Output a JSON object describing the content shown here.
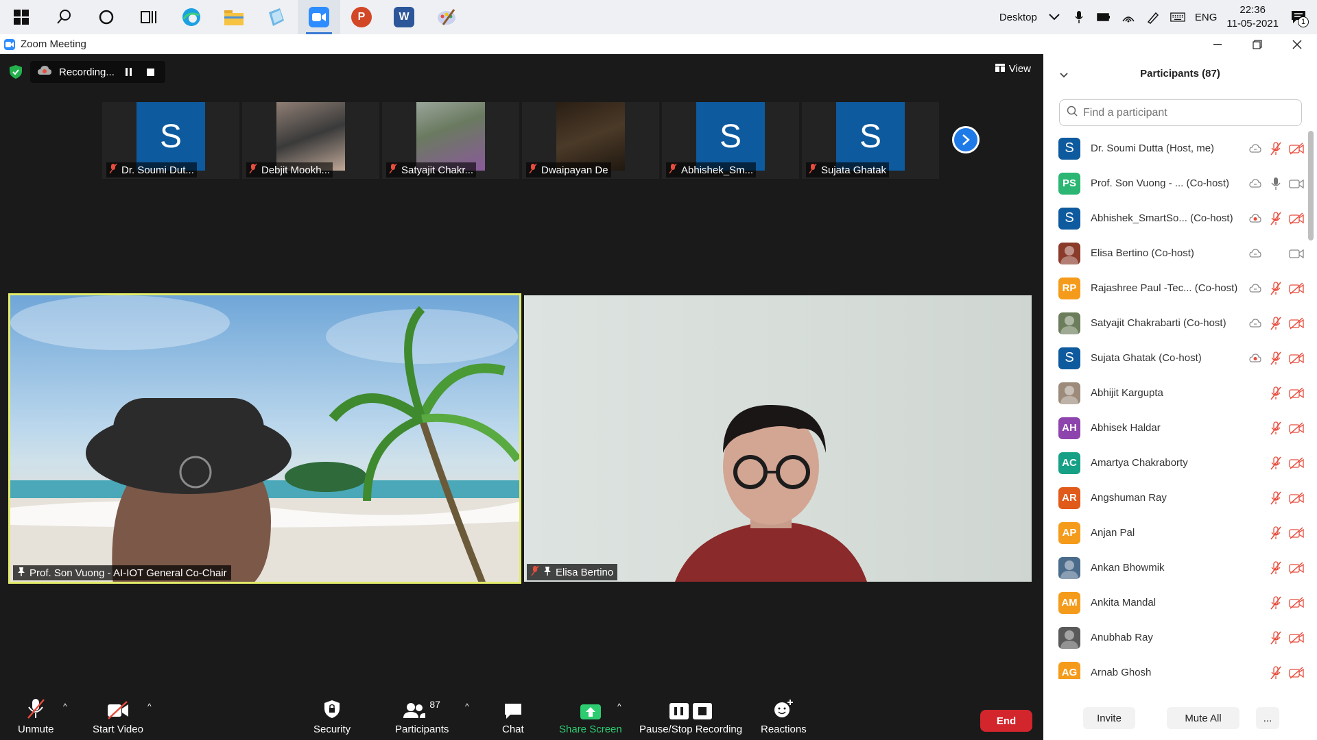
{
  "taskbar": {
    "apps": [
      {
        "name": "windows-start",
        "color": "#111111"
      },
      {
        "name": "search",
        "color": "#111111"
      },
      {
        "name": "cortana",
        "color": "#111111"
      },
      {
        "name": "task-view",
        "color": "#111111"
      },
      {
        "name": "edge",
        "color": "#1ba1e2"
      },
      {
        "name": "file-explorer",
        "color": "#f6c343"
      },
      {
        "name": "notes",
        "color": "#6fb7e6"
      },
      {
        "name": "zoom",
        "color": "#2d8cff"
      },
      {
        "name": "powerpoint",
        "color": "#d24726"
      },
      {
        "name": "word",
        "color": "#2b579a"
      },
      {
        "name": "paint",
        "color": "#9aa7d6"
      }
    ],
    "desktop_label": "Desktop",
    "lang": "ENG",
    "time": "22:36",
    "date": "11-05-2021",
    "notification_count": "1"
  },
  "window": {
    "title": "Zoom Meeting"
  },
  "meeting": {
    "recording_label": "Recording...",
    "view_label": "View",
    "thumbnails": [
      {
        "name": "Dr. Soumi Dut...",
        "initial": "S",
        "photo": ""
      },
      {
        "name": "Debjit Mookh...",
        "initial": "",
        "photo": "photo1"
      },
      {
        "name": "Satyajit Chakr...",
        "initial": "",
        "photo": "photo2"
      },
      {
        "name": "Dwaipayan De",
        "initial": "",
        "photo": "photo3"
      },
      {
        "name": "Abhishek_Sm...",
        "initial": "S",
        "photo": ""
      },
      {
        "name": "Sujata Ghatak",
        "initial": "S",
        "photo": ""
      }
    ],
    "main_videos": [
      {
        "name": "Prof. Son Vuong - AI-IOT General Co-Chair"
      },
      {
        "name": "Elisa Bertino"
      }
    ]
  },
  "toolbar": {
    "unmute": "Unmute",
    "start_video": "Start Video",
    "security": "Security",
    "participants": "Participants",
    "participants_count": "87",
    "chat": "Chat",
    "share_screen": "Share Screen",
    "pause_stop_recording": "Pause/Stop Recording",
    "reactions": "Reactions",
    "end": "End",
    "share_color": "#2ecc71",
    "end_color": "#d3252c"
  },
  "panel": {
    "title": "Participants (87)",
    "search_placeholder": "Find a participant",
    "participants": [
      {
        "name": "Dr. Soumi Dutta (Host, me)",
        "initials": "S",
        "color": "#0e5a9e",
        "big": true,
        "audio": "muted",
        "video": "off",
        "cloud": true,
        "cloud_red": false
      },
      {
        "name": "Prof. Son Vuong - ... (Co-host)",
        "initials": "PS",
        "color": "#2bb673",
        "big": false,
        "audio": "on",
        "video": "on",
        "cloud": true,
        "cloud_red": false
      },
      {
        "name": "Abhishek_SmartSo... (Co-host)",
        "initials": "S",
        "color": "#0e5a9e",
        "big": true,
        "audio": "muted",
        "video": "off",
        "cloud": true,
        "cloud_red": true
      },
      {
        "name": "Elisa Bertino (Co-host)",
        "initials": "",
        "color": "#8a3b2a",
        "big": false,
        "audio": "none",
        "video": "on",
        "cloud": true,
        "cloud_red": false
      },
      {
        "name": "Rajashree Paul -Tec... (Co-host)",
        "initials": "RP",
        "color": "#f59b1b",
        "big": false,
        "audio": "muted",
        "video": "off",
        "cloud": true,
        "cloud_red": false
      },
      {
        "name": "Satyajit Chakrabarti (Co-host)",
        "initials": "",
        "color": "#6b7d5a",
        "big": false,
        "audio": "muted",
        "video": "off",
        "cloud": true,
        "cloud_red": false
      },
      {
        "name": "Sujata Ghatak (Co-host)",
        "initials": "S",
        "color": "#0e5a9e",
        "big": true,
        "audio": "muted",
        "video": "off",
        "cloud": true,
        "cloud_red": true
      },
      {
        "name": "Abhijit Kargupta",
        "initials": "",
        "color": "#9c8a7a",
        "big": false,
        "audio": "muted",
        "video": "off",
        "cloud": false,
        "cloud_red": false
      },
      {
        "name": "Abhisek Haldar",
        "initials": "AH",
        "color": "#8e44ad",
        "big": false,
        "audio": "muted",
        "video": "off",
        "cloud": false,
        "cloud_red": false
      },
      {
        "name": "Amartya Chakraborty",
        "initials": "AC",
        "color": "#16a085",
        "big": false,
        "audio": "muted",
        "video": "off",
        "cloud": false,
        "cloud_red": false
      },
      {
        "name": "Angshuman Ray",
        "initials": "AR",
        "color": "#e05a1a",
        "big": false,
        "audio": "muted",
        "video": "off",
        "cloud": false,
        "cloud_red": false
      },
      {
        "name": "Anjan Pal",
        "initials": "AP",
        "color": "#f59b1b",
        "big": false,
        "audio": "muted",
        "video": "off",
        "cloud": false,
        "cloud_red": false
      },
      {
        "name": "Ankan Bhowmik",
        "initials": "",
        "color": "#4a6b8a",
        "big": false,
        "audio": "muted",
        "video": "off",
        "cloud": false,
        "cloud_red": false
      },
      {
        "name": "Ankita Mandal",
        "initials": "AM",
        "color": "#f59b1b",
        "big": false,
        "audio": "muted",
        "video": "off",
        "cloud": false,
        "cloud_red": false
      },
      {
        "name": "Anubhab Ray",
        "initials": "",
        "color": "#5a5a5a",
        "big": false,
        "audio": "muted",
        "video": "off",
        "cloud": false,
        "cloud_red": false
      },
      {
        "name": "Arnab Ghosh",
        "initials": "AG",
        "color": "#f59b1b",
        "big": false,
        "audio": "muted",
        "video": "off",
        "cloud": false,
        "cloud_red": false
      }
    ],
    "invite": "Invite",
    "mute_all": "Mute All",
    "more": "..."
  }
}
